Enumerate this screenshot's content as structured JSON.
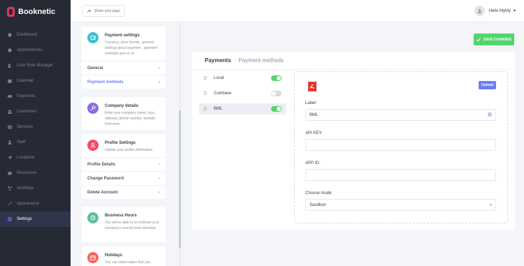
{
  "app": {
    "name": "Booknetic"
  },
  "sidebar": {
    "items": [
      {
        "label": "Dashboard",
        "icon": "dashboard-icon"
      },
      {
        "label": "Appointments",
        "icon": "appointments-icon"
      },
      {
        "label": "User Role Manager",
        "icon": "user-role-icon"
      },
      {
        "label": "Calendar",
        "icon": "calendar-icon"
      },
      {
        "label": "Payments",
        "icon": "payments-icon"
      },
      {
        "label": "Customers",
        "icon": "customers-icon"
      },
      {
        "label": "Services",
        "icon": "services-icon"
      },
      {
        "label": "Staff",
        "icon": "staff-icon"
      },
      {
        "label": "Locations",
        "icon": "locations-icon"
      },
      {
        "label": "Resources",
        "icon": "resources-icon"
      },
      {
        "label": "Workflow",
        "icon": "workflow-icon"
      },
      {
        "label": "Appearance",
        "icon": "appearance-icon"
      },
      {
        "label": "Settings",
        "icon": "settings-icon",
        "active": true
      }
    ]
  },
  "topbar": {
    "share_label": "Share your page",
    "greeting": "Hello MyMy"
  },
  "settings_menu": {
    "payment": {
      "title": "Payment settings",
      "desc": "Currency, price format , general settings about payment , payment methods and so on",
      "items": [
        {
          "label": "General"
        },
        {
          "label": "Payment methods",
          "active": true
        }
      ]
    },
    "company": {
      "title": "Company details",
      "desc": "Enter your company name, logo, address, phone number, website from here"
    },
    "profile": {
      "title": "Profile Settings",
      "desc": "Update your profile information",
      "items": [
        {
          "label": "Profile Details"
        },
        {
          "label": "Change Password"
        },
        {
          "label": "Delete Account"
        }
      ]
    },
    "hours": {
      "title": "Business Hours",
      "desc": "You will be able to co-ordinate your company's overall work schedule"
    },
    "holidays": {
      "title": "Holidays",
      "desc": "You can select dates that you"
    }
  },
  "main": {
    "save_label": "SAVE CHANGES",
    "breadcrumb": {
      "title": "Payments",
      "separator": "›",
      "subtitle": "Payment methods"
    },
    "methods": [
      {
        "name": "Local",
        "enabled": true
      },
      {
        "name": "Coinbase",
        "enabled": false
      },
      {
        "name": "BML",
        "enabled": true,
        "active": true
      }
    ],
    "detail": {
      "upload_label": "Upload",
      "label_label": "Label:",
      "label_value": "BML",
      "api_key_label": "API KEY:",
      "api_key_value": "",
      "app_id_label": "APP ID:",
      "app_id_value": "",
      "mode_label": "Choose mode:",
      "mode_value": "Sandbox"
    }
  },
  "colors": {
    "sidebar_bg": "#262a35",
    "accent": "#6f7bf7",
    "save_green": "#53d56c",
    "brand_red": "#e1355e"
  }
}
